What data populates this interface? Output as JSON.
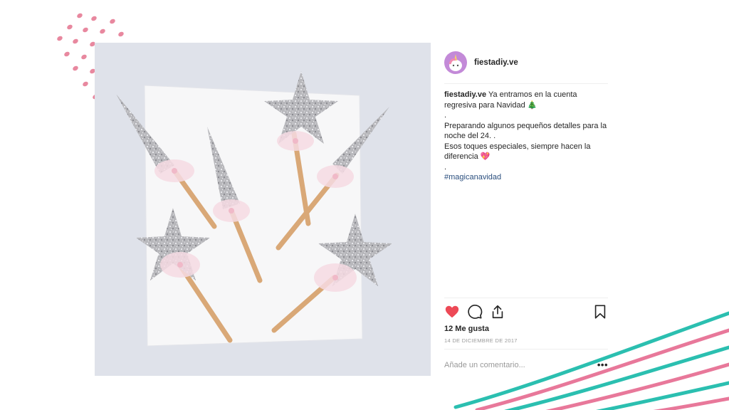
{
  "post": {
    "username": "fiestadiy.ve",
    "photo_alt": "Varitas mágicas con estrellas y conos de glitter plateado y tul rosado",
    "caption": {
      "username": "fiestadiy.ve",
      "lines": [
        "Ya entramos en la cuenta regresiva para Navidad 🎄",
        ".",
        "Preparando algunos pequeños detalles para la noche del 24. .",
        "Esos toques especiales, siempre hacen la diferencia 💖",
        "."
      ],
      "hashtag": "#magicanavidad"
    },
    "actions": {
      "like_icon": "heart-icon",
      "comment_icon": "comment-icon",
      "share_icon": "share-icon",
      "save_icon": "bookmark-icon",
      "liked": true
    },
    "likes_text": "12 Me gusta",
    "date": "14 DE DICIEMBRE DE 2017",
    "comment": {
      "placeholder": "Añade un comentario...",
      "more_label": "•••"
    }
  },
  "colors": {
    "heart": "#ed4956",
    "hashtag": "#2b4f7e",
    "dots": "#e8889f",
    "stripe_teal": "#2bbfb0",
    "stripe_pink": "#e8789a",
    "avatar_bg": "#c38ad8"
  }
}
